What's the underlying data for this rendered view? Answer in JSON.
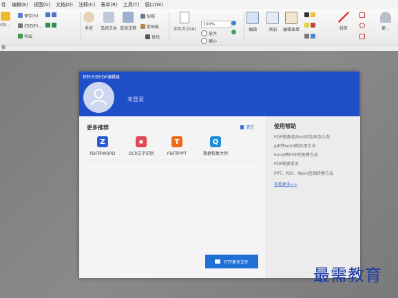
{
  "menu": [
    "件",
    "编辑(E)",
    "视图(V)",
    "文档(D)",
    "注释(C)",
    "表单(R)",
    "工具(T)",
    "窗口(W)"
  ],
  "toolbar": {
    "save": "保存(S)",
    "print": "打印(P)...",
    "export": "导出",
    "open_short": "(O)...",
    "hand": "手型",
    "select_text": "选择文本",
    "select_annot": "选择注释",
    "snapshot": "快照",
    "clipboard": "剪贴板",
    "find": "查找",
    "actual_size": "实际大小(A)",
    "zoom_value": "100%",
    "zoom_in": "放大",
    "zoom_out": "缩小",
    "edit": "编辑",
    "add": "添加",
    "edit_form": "编辑表单",
    "line": "线条",
    "more": "更..."
  },
  "status_left": "指",
  "dialog": {
    "title": "转转大师PDF编辑器",
    "not_logged_in": "未登录",
    "more_recommend": "更多推荐",
    "clear": "清空",
    "tools": [
      {
        "label": "PDF转WORD",
        "glyph": "Z",
        "color": "#2a5bd7"
      },
      {
        "label": "OCR文字识别",
        "glyph": "◼",
        "color": "#e04a55"
      },
      {
        "label": "PDF转PPT",
        "glyph": "T",
        "color": "#ef6a1e"
      },
      {
        "label": "数据恢复大师",
        "glyph": "Q",
        "color": "#1d8fd8"
      }
    ],
    "open_more": "打开更多文件",
    "help_title": "使用帮助",
    "help_items": [
      "PDF转换成Word后乱码怎么办",
      "pdf转word的实用方法",
      "Excel转PDF的免费方法",
      "PDF转换常识",
      "PPT、PDF、Word互相转换方法"
    ],
    "help_more": "查看更多>>"
  },
  "watermark": "最需教育"
}
